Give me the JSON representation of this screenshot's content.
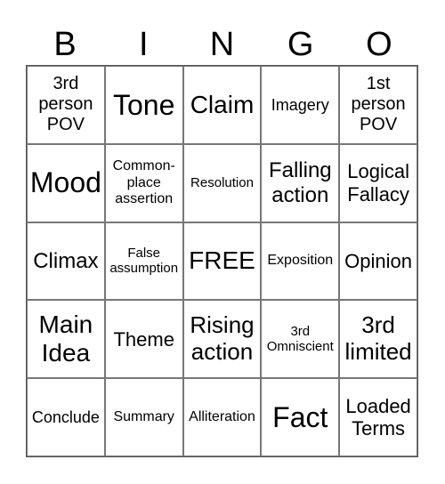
{
  "header": [
    "B",
    "I",
    "N",
    "G",
    "O"
  ],
  "cells": [
    [
      "3rd person POV",
      "Tone",
      "Claim",
      "Imagery",
      "1st person POV"
    ],
    [
      "Mood",
      "Common-place assertion",
      "Resolution",
      "Falling action",
      "Logical Fallacy"
    ],
    [
      "Climax",
      "False assumption",
      "FREE",
      "Exposition",
      "Opinion"
    ],
    [
      "Main Idea",
      "Theme",
      "Rising action",
      "3rd Omniscient",
      "3rd limited"
    ],
    [
      "Conclude",
      "Summary",
      "Alliteration",
      "Fact",
      "Loaded Terms"
    ]
  ]
}
